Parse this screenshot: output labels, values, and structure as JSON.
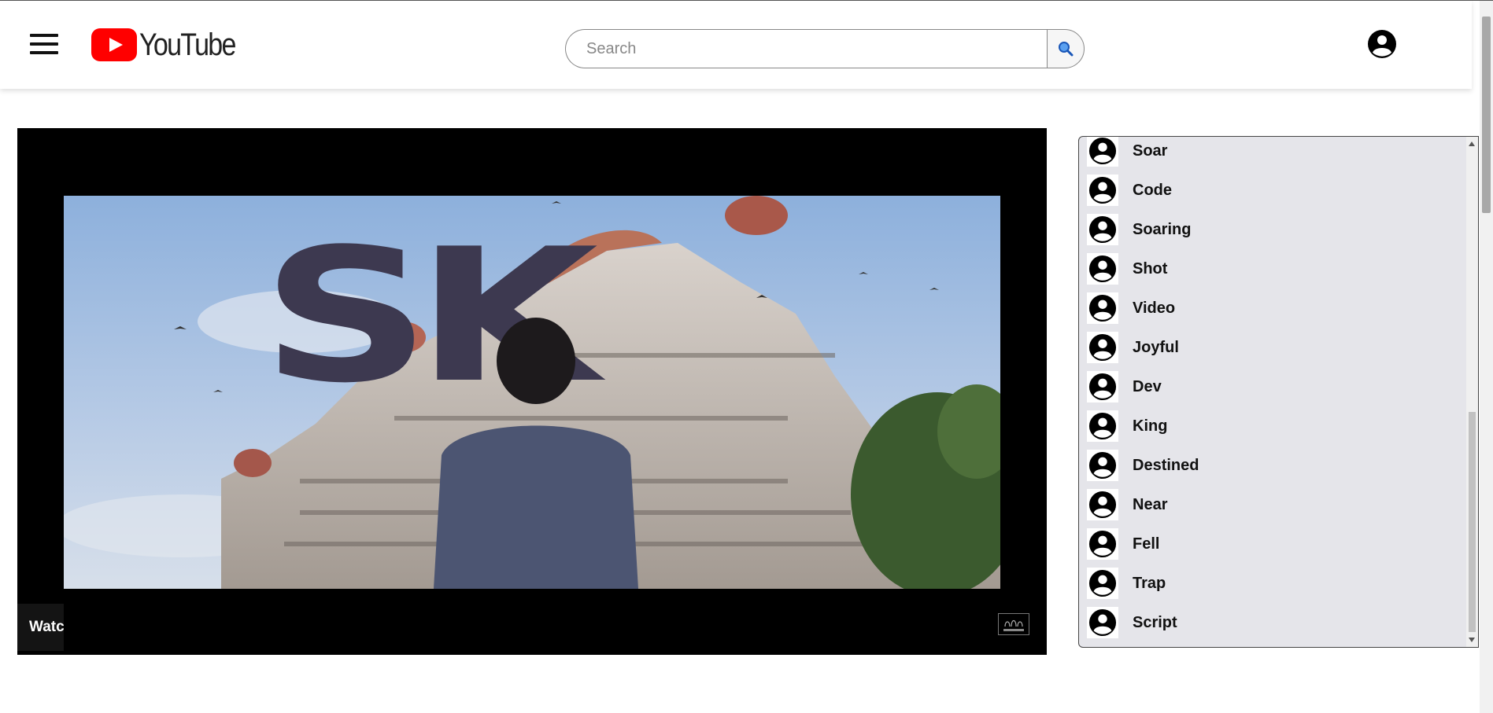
{
  "header": {
    "logo_text": "YouTube",
    "search_placeholder": "Search"
  },
  "video": {
    "overlay_title": "SK",
    "watch_label": "Watch"
  },
  "list": {
    "items": [
      {
        "label": "Soar"
      },
      {
        "label": "Code"
      },
      {
        "label": "Soaring"
      },
      {
        "label": "Shot"
      },
      {
        "label": "Video"
      },
      {
        "label": "Joyful"
      },
      {
        "label": "Dev"
      },
      {
        "label": "King"
      },
      {
        "label": "Destined"
      },
      {
        "label": "Near"
      },
      {
        "label": "Fell"
      },
      {
        "label": "Trap"
      },
      {
        "label": "Script"
      }
    ]
  },
  "icons": {
    "menu": "hamburger-menu-icon",
    "search": "magnifier-icon",
    "account": "account-circle-icon",
    "list_avatar": "user-avatar-icon"
  },
  "colors": {
    "brand": "#ff0000",
    "list_background": "#e5e5ea",
    "search_icon": "#1a73e8"
  }
}
